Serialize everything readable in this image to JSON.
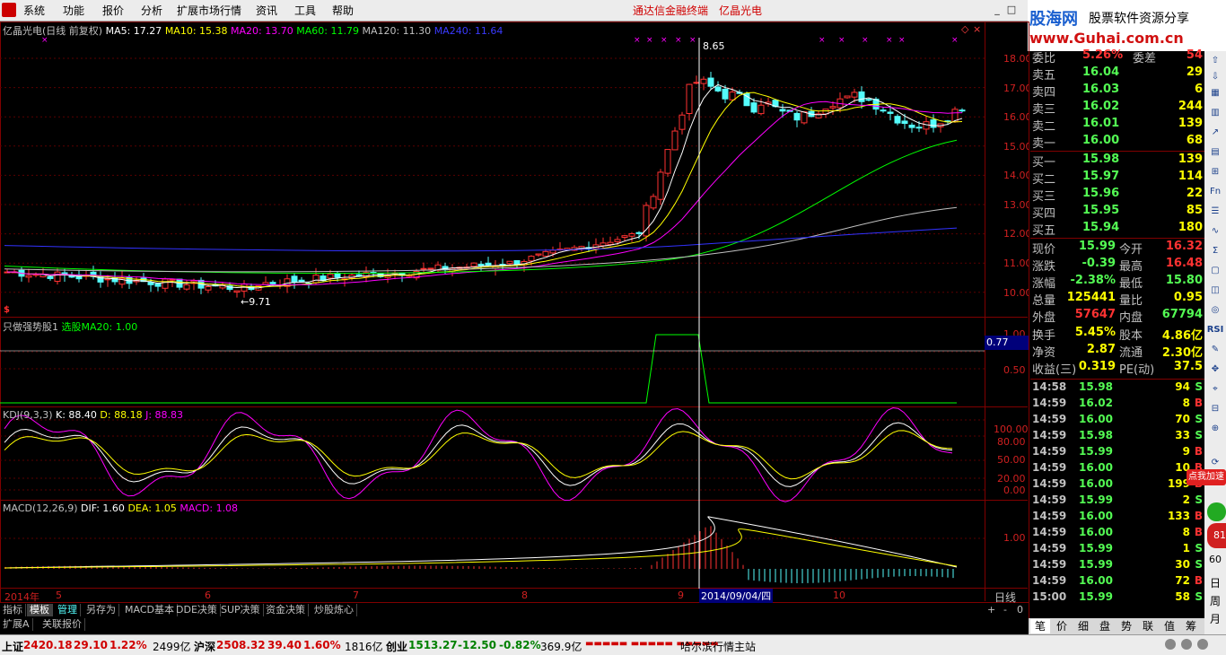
{
  "menu": {
    "items": [
      "系统",
      "功能",
      "报价",
      "分析",
      "扩展市场行情",
      "资讯",
      "工具",
      "帮助"
    ],
    "link1": "通达信金融终端",
    "link2": "亿晶光电"
  },
  "logo": {
    "line1": "股海网",
    "line2": "股票软件资源分享",
    "line3": "www.Guhai.com.cn"
  },
  "chart": {
    "title": "亿晶光电(日线 前复权)",
    "ma5": "MA5: 17.27",
    "ma10": "MA10: 15.38",
    "ma20": "MA20: 13.70",
    "ma60": "MA60: 11.79",
    "ma120": "MA120: 11.30",
    "ma240": "MA240: 11.64",
    "high_label": "8.65",
    "low_label": "9.71",
    "price_ticks": [
      "18.00",
      "17.00",
      "16.00",
      "15.00",
      "14.00",
      "13.00",
      "12.00",
      "11.00",
      "10.00"
    ],
    "colors": {
      "up": "#ff3232",
      "down": "#54fcfc",
      "ma5": "#ffffff",
      "ma10": "#ffff00",
      "ma20": "#ff00ff",
      "ma60": "#00ff00",
      "ma120": "#c0c0c0",
      "ma240": "#3232ff"
    }
  },
  "panel2": {
    "name": "只做强势股1",
    "param": "选股MA20: 1.00",
    "ticks": [
      "1.00",
      "0.50"
    ],
    "value": "0.77"
  },
  "kdj": {
    "name": "KDJ(9,3,3)",
    "k": "K: 88.40",
    "d": "D: 88.18",
    "j": "J: 88.83",
    "ticks": [
      "100.00",
      "80.00",
      "50.00",
      "20.00",
      "0.00"
    ]
  },
  "macd": {
    "name": "MACD(12,26,9)",
    "dif": "DIF: 1.60",
    "dea": "DEA: 1.05",
    "macd": "MACD: 1.08",
    "ticks": [
      "1.00"
    ]
  },
  "xaxis": {
    "year": "2014年",
    "months": [
      "5",
      "6",
      "7",
      "8",
      "9",
      "10"
    ],
    "cursor_date": "2014/09/04/四",
    "period": "日线"
  },
  "tabs": [
    "指标",
    "模板",
    "管理",
    "另存为",
    "MACD基本",
    "DDE决策",
    "SUP决策",
    "资金决策",
    "炒股炼心"
  ],
  "tabs2": [
    "扩展A",
    "关联报价"
  ],
  "quote": {
    "wb_label": "委比",
    "wb_value": "5.26%",
    "wc_label": "委差",
    "wc_value": "54",
    "sells": [
      {
        "label": "卖五",
        "price": "16.04",
        "vol": "29"
      },
      {
        "label": "卖四",
        "price": "16.03",
        "vol": "6"
      },
      {
        "label": "卖三",
        "price": "16.02",
        "vol": "244"
      },
      {
        "label": "卖二",
        "price": "16.01",
        "vol": "139"
      },
      {
        "label": "卖一",
        "price": "16.00",
        "vol": "68"
      }
    ],
    "buys": [
      {
        "label": "买一",
        "price": "15.98",
        "vol": "139"
      },
      {
        "label": "买二",
        "price": "15.97",
        "vol": "114"
      },
      {
        "label": "买三",
        "price": "15.96",
        "vol": "22"
      },
      {
        "label": "买四",
        "price": "15.95",
        "vol": "85"
      },
      {
        "label": "买五",
        "price": "15.94",
        "vol": "180"
      }
    ],
    "stats": [
      [
        "现价",
        "15.99",
        "今开",
        "16.32"
      ],
      [
        "涨跌",
        "-0.39",
        "最高",
        "16.48"
      ],
      [
        "涨幅",
        "-2.38%",
        "最低",
        "15.80"
      ],
      [
        "总量",
        "125441",
        "量比",
        "0.95"
      ],
      [
        "外盘",
        "57647",
        "内盘",
        "67794"
      ],
      [
        "换手",
        "5.45%",
        "股本",
        "4.86亿"
      ],
      [
        "净资",
        "2.87",
        "流通",
        "2.30亿"
      ],
      [
        "收益(三)",
        "0.319",
        "PE(动)",
        "37.5"
      ]
    ],
    "ticks": [
      [
        "14:58",
        "15.98",
        "94",
        "S"
      ],
      [
        "14:59",
        "16.02",
        "8",
        "B"
      ],
      [
        "14:59",
        "16.00",
        "70",
        "S"
      ],
      [
        "14:59",
        "15.98",
        "33",
        "S"
      ],
      [
        "14:59",
        "15.99",
        "9",
        "B"
      ],
      [
        "14:59",
        "16.00",
        "10",
        "B"
      ],
      [
        "14:59",
        "16.00",
        "199",
        "B"
      ],
      [
        "14:59",
        "15.99",
        "2",
        "S"
      ],
      [
        "14:59",
        "16.00",
        "133",
        "B"
      ],
      [
        "14:59",
        "16.00",
        "8",
        "B"
      ],
      [
        "14:59",
        "15.99",
        "1",
        "S"
      ],
      [
        "14:59",
        "15.99",
        "30",
        "S"
      ],
      [
        "14:59",
        "16.00",
        "72",
        "B"
      ],
      [
        "15:00",
        "15.99",
        "58",
        "S"
      ]
    ]
  },
  "sidebar_icons": [
    "日",
    "周",
    "月",
    "60"
  ],
  "sidebar_rsi": "RSI",
  "add_badge": "点我加速",
  "bottom_tabs": [
    "笔",
    "价",
    "细",
    "盘",
    "势",
    "联",
    "值",
    "筹"
  ],
  "status": {
    "sh_label": "上证",
    "sh_val": "2420.18",
    "sh_chg": "29.10",
    "sh_pct": "1.22%",
    "sh_amt": "2499亿",
    "sz_label": "沪深",
    "sz_val": "2508.32",
    "sz_chg": "39.40",
    "sz_pct": "1.60%",
    "sz_amt": "1816亿",
    "cy_label": "创业",
    "cy_val": "1513.27",
    "cy_chg": "-12.50",
    "cy_pct": "-0.82%",
    "cy_amt": "369.9亿",
    "server": "哈尔滨行情主站"
  }
}
